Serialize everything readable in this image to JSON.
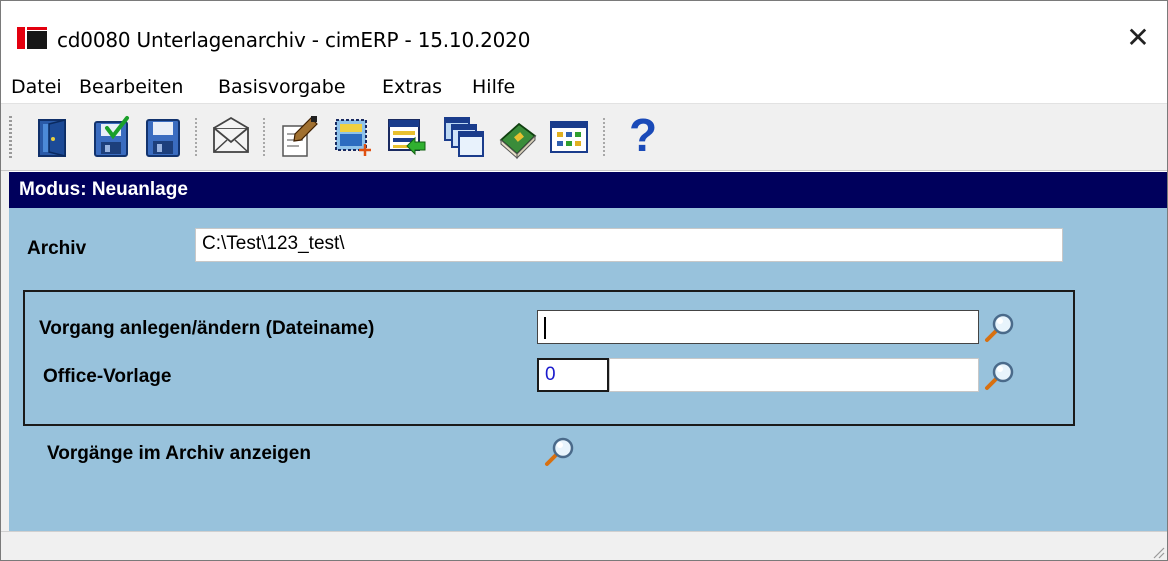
{
  "window": {
    "title": "cd0080 Unterlagenarchiv - cimERP - 15.10.2020",
    "close_glyph": "✕"
  },
  "menu": {
    "items": [
      "Datei",
      "Bearbeiten",
      "Basisvorgabe",
      "Extras",
      "Hilfe"
    ]
  },
  "toolbar": {
    "buttons": [
      "exit-door-icon",
      "save-check-icon",
      "save-icon",
      "mail-icon",
      "edit-document-icon",
      "select-add-icon",
      "list-transfer-icon",
      "windows-stack-icon",
      "book-icon",
      "grid-table-icon",
      "help-icon"
    ],
    "help_glyph": "?"
  },
  "mode_bar": {
    "label": "Modus: Neuanlage"
  },
  "form": {
    "archiv_label": "Archiv",
    "archiv_value": "C:\\Test\\123_test\\",
    "vorgang_label": "Vorgang anlegen/ändern (Dateiname)",
    "vorgang_value": "",
    "office_label": "Office-Vorlage",
    "office_code": "0",
    "office_name": "",
    "show_label": "Vorgänge im Archiv anzeigen"
  },
  "colors": {
    "mode_bar_bg": "#00005c",
    "panel_bg": "#98c2dc",
    "code_text": "#1a1acc"
  }
}
